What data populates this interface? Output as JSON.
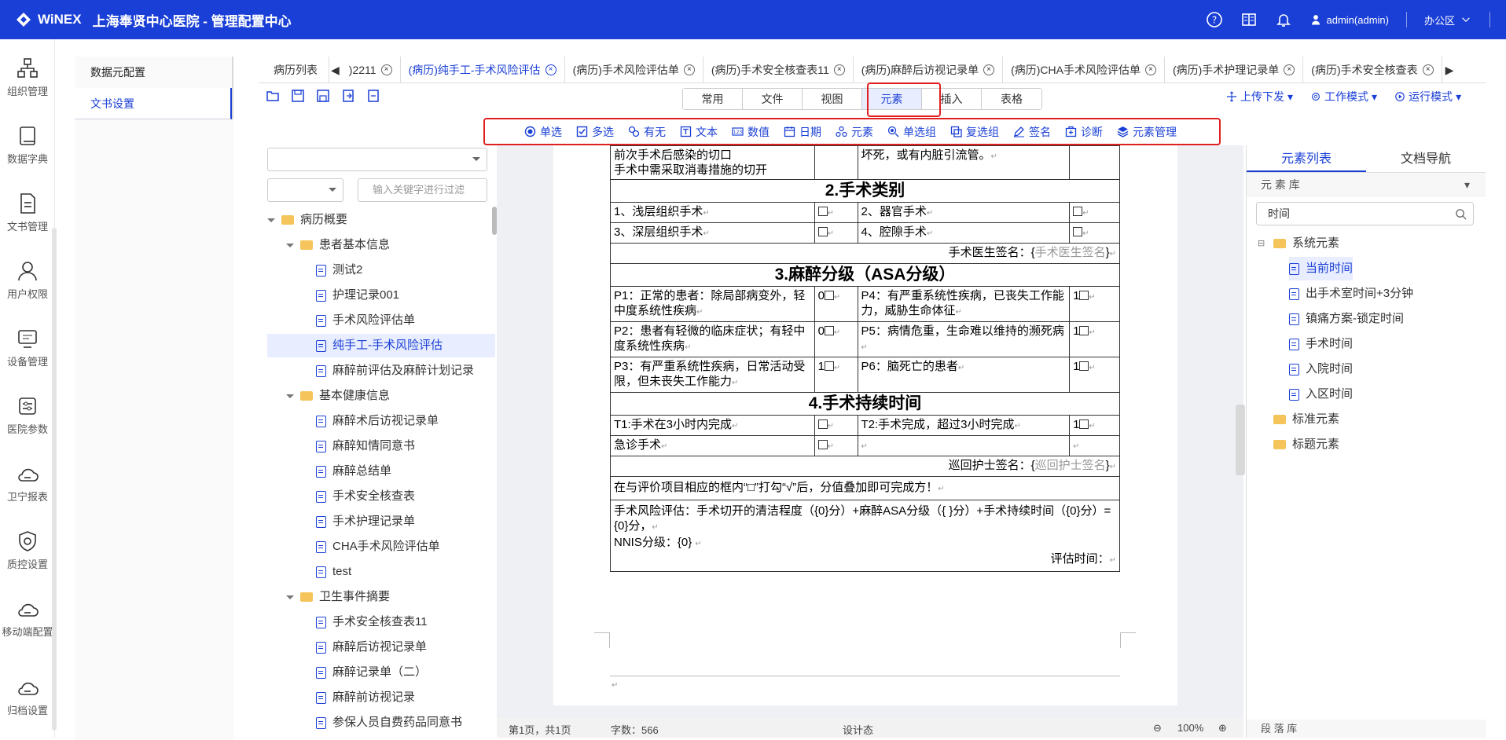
{
  "header": {
    "brand": "WiNEX",
    "title": "上海奉贤中心医院 - 管理配置中心",
    "user": "admin(admin)",
    "office": "办公区"
  },
  "leftnav": [
    "组织管理",
    "数据字典",
    "文书管理",
    "用户权限",
    "设备管理",
    "医院参数",
    "卫宁报表",
    "质控设置",
    "移动端配置",
    "归档设置"
  ],
  "sidepanel": {
    "items": [
      "数据元配置",
      "文书设置"
    ]
  },
  "doctabs": {
    "list_label": "病历列表",
    "tabs": [
      ")2211",
      "(病历)纯手工-手术风险评估",
      "(病历)手术风险评估单",
      "(病历)手术安全核查表11",
      "(病历)麻醉后访视记录单",
      "(病历)CHA手术风险评估单",
      "(病历)手术护理记录单",
      "(病历)手术安全核查表"
    ]
  },
  "ribbon_tabs": [
    "常用",
    "文件",
    "视图",
    "元素",
    "插入",
    "表格"
  ],
  "element_bar": [
    "单选",
    "多选",
    "有无",
    "文本",
    "数值",
    "日期",
    "元素",
    "单选组",
    "复选组",
    "签名",
    "诊断",
    "元素管理"
  ],
  "right_tools": [
    "上传下发",
    "工作模式",
    "运行模式"
  ],
  "filter": {
    "placeholder": "输入关键字进行过滤"
  },
  "tree": [
    {
      "label": "病历概要",
      "level": 0,
      "type": "folder"
    },
    {
      "label": "患者基本信息",
      "level": 1,
      "type": "folder"
    },
    {
      "label": "测试2",
      "level": 2,
      "type": "doc"
    },
    {
      "label": "护理记录001",
      "level": 2,
      "type": "doc"
    },
    {
      "label": "手术风险评估单",
      "level": 2,
      "type": "doc"
    },
    {
      "label": "纯手工-手术风险评估",
      "level": 2,
      "type": "doc",
      "selected": true
    },
    {
      "label": "麻醉前评估及麻醉计划记录",
      "level": 2,
      "type": "doc"
    },
    {
      "label": "基本健康信息",
      "level": 1,
      "type": "folder"
    },
    {
      "label": "麻醉术后访视记录单",
      "level": 2,
      "type": "doc"
    },
    {
      "label": "麻醉知情同意书",
      "level": 2,
      "type": "doc"
    },
    {
      "label": "麻醉总结单",
      "level": 2,
      "type": "doc"
    },
    {
      "label": "手术安全核查表",
      "level": 2,
      "type": "doc"
    },
    {
      "label": "手术护理记录单",
      "level": 2,
      "type": "doc"
    },
    {
      "label": "CHA手术风险评估单",
      "level": 2,
      "type": "doc"
    },
    {
      "label": "test",
      "level": 2,
      "type": "doc"
    },
    {
      "label": "卫生事件摘要",
      "level": 1,
      "type": "folder"
    },
    {
      "label": "手术安全核查表11",
      "level": 2,
      "type": "doc"
    },
    {
      "label": "麻醉后访视记录单",
      "level": 2,
      "type": "doc"
    },
    {
      "label": "麻醉记录单（二）",
      "level": 2,
      "type": "doc"
    },
    {
      "label": "麻醉前访视记录",
      "level": 2,
      "type": "doc"
    },
    {
      "label": "参保人员自费药品同意书",
      "level": 2,
      "type": "doc"
    }
  ],
  "doc": {
    "top_left": "前次手术后感染的切口\n手术中需采取消毒措施的切开",
    "top_right": "坏死，或有内脏引流管。",
    "sec2": "2.手术类别",
    "r2a1": "1、浅层组织手术",
    "r2a2": "2、器官手术",
    "r2b1": "3、深层组织手术",
    "r2b2": "4、腔隙手术",
    "sign1_label": "手术医生签名：{",
    "sign1_ph": "手术医生签名",
    "sign1_end": "}",
    "sec3": "3.麻醉分级（ASA分级）",
    "p1": "P1：正常的患者：除局部病变外，轻中度系统性疾病",
    "p1v": "0",
    "p4": "P4：有严重系统性疾病，已丧失工作能力，威胁生命体征",
    "p4v": "1",
    "p2": "P2：患者有轻微的临床症状；有轻中度系统性疾病",
    "p2v": "0",
    "p5": "P5：病情危重，生命难以维持的濒死病",
    "p5v": "1",
    "p3": "P3：有严重系统性疾病，日常活动受限，但未丧失工作能力",
    "p3v": "1",
    "p6": "P6：脑死亡的患者",
    "p6v": "1",
    "sec4": "4.手术持续时间",
    "t1": "T1:手术在3小时内完成",
    "t2": "T2:手术完成，超过3小时完成",
    "t2v": "1",
    "emerg": "急诊手术",
    "sign2_label": "巡回护士签名：{",
    "sign2_ph": "巡回护士签名",
    "sign2_end": "}",
    "note": "在与评价项目相应的框内“□”打勾“√”后，分值叠加即可完成方！",
    "formula": "手术风险评估：手术切开的清洁程度（{0}分）+麻醉ASA分级（{ }分）+手术持续时间（{0}分）={0}分，",
    "nnis": "NNIS分级：{0}",
    "eval_time": "评估时间："
  },
  "status": {
    "page": "第1页，共1页",
    "words": "字数：566",
    "mode": "设计态",
    "zoom": "100%"
  },
  "rpanel": {
    "tabs": [
      "元素列表",
      "文档导航"
    ],
    "lib": "元 素 库",
    "search": "时间",
    "bottom": "段 落 库",
    "tree": [
      {
        "label": "系统元素",
        "level": 0,
        "type": "folder"
      },
      {
        "label": "当前时间",
        "level": 1,
        "type": "doc",
        "selected": true
      },
      {
        "label": "出手术室时间+3分钟",
        "level": 1,
        "type": "doc"
      },
      {
        "label": "镇痛方案-锁定时间",
        "level": 1,
        "type": "doc"
      },
      {
        "label": "手术时间",
        "level": 1,
        "type": "doc"
      },
      {
        "label": "入院时间",
        "level": 1,
        "type": "doc"
      },
      {
        "label": "入区时间",
        "level": 1,
        "type": "doc"
      },
      {
        "label": "标准元素",
        "level": 0,
        "type": "folder"
      },
      {
        "label": "标题元素",
        "level": 0,
        "type": "folder"
      }
    ]
  }
}
